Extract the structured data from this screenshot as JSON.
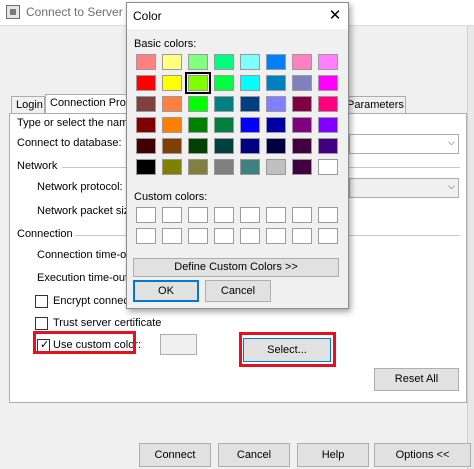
{
  "background_window": {
    "title": "Connect to Server",
    "tabs": [
      {
        "label": "Login"
      },
      {
        "label": "Connection Prope"
      },
      {
        "label": "Parameters"
      }
    ],
    "type_label": "Type or select the nam",
    "connect_db_label": "Connect to database:",
    "network_heading": "Network",
    "network_protocol_label": "Network protocol:",
    "packet_size_label": "Network packet siz",
    "connection_heading": "Connection",
    "conn_timeout_label": "Connection time-ou",
    "exec_timeout_label": "Execution time-out:",
    "encrypt_label": "Encrypt connect",
    "trust_label": "Trust server certificate",
    "custom_color_label": "Use custom color:",
    "custom_color_checked": true,
    "select_button": "Select...",
    "reset_button": "Reset All",
    "bottom_buttons": {
      "connect": "Connect",
      "cancel": "Cancel",
      "help": "Help",
      "options": "Options <<"
    }
  },
  "color_dialog": {
    "title": "Color",
    "close_icon": "close-icon",
    "basic_colors_label": "Basic colors:",
    "basic_colors": [
      [
        "#FF8080",
        "#FFFF80",
        "#80FF80",
        "#00FF80",
        "#80FFFF",
        "#0080FF",
        "#FF80C0",
        "#FF80FF"
      ],
      [
        "#FF0000",
        "#FFFF00",
        "#80FF00",
        "#00FF40",
        "#00FFFF",
        "#0080C0",
        "#8080C0",
        "#FF00FF"
      ],
      [
        "#804040",
        "#FF8040",
        "#00FF00",
        "#008080",
        "#004080",
        "#8080FF",
        "#800040",
        "#FF0080"
      ],
      [
        "#800000",
        "#FF8000",
        "#008000",
        "#008040",
        "#0000FF",
        "#0000A0",
        "#800080",
        "#8000FF"
      ],
      [
        "#400000",
        "#804000",
        "#004000",
        "#004040",
        "#000080",
        "#000040",
        "#400040",
        "#400080"
      ],
      [
        "#000000",
        "#808000",
        "#808040",
        "#808080",
        "#408080",
        "#C0C0C0",
        "#400040",
        "#FFFFFF"
      ]
    ],
    "selected_color": {
      "row": 1,
      "col": 2
    },
    "custom_colors_label": "Custom colors:",
    "custom_colors": [
      [
        "#FFFFFF",
        "#FFFFFF",
        "#FFFFFF",
        "#FFFFFF",
        "#FFFFFF",
        "#FFFFFF",
        "#FFFFFF",
        "#FFFFFF"
      ],
      [
        "#FFFFFF",
        "#FFFFFF",
        "#FFFFFF",
        "#FFFFFF",
        "#FFFFFF",
        "#FFFFFF",
        "#FFFFFF",
        "#FFFFFF"
      ]
    ],
    "define_button": "Define Custom Colors >>",
    "ok_button": "OK",
    "cancel_button": "Cancel"
  },
  "highlight_color": "#E8101F"
}
